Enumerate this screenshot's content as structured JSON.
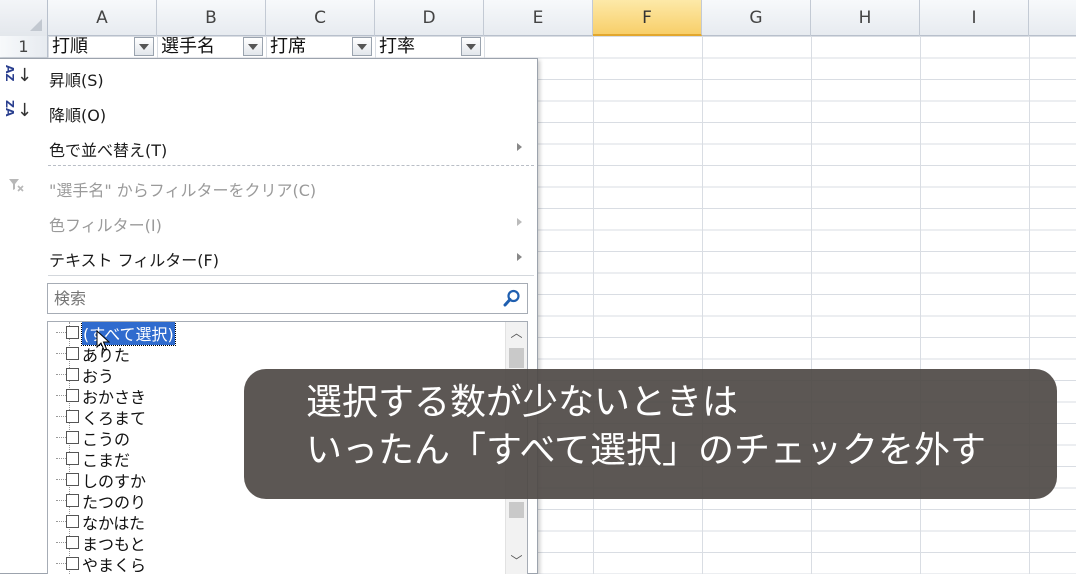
{
  "columns": [
    "A",
    "B",
    "C",
    "D",
    "E",
    "F",
    "G",
    "H",
    "I"
  ],
  "selected_column": "F",
  "row_numbers": [
    "1"
  ],
  "header_row": {
    "A": "打順",
    "B": "選手名",
    "C": "打席",
    "D": "打率"
  },
  "filter_menu": {
    "sort_ascending": "昇順(S)",
    "sort_descending": "降順(O)",
    "sort_by_color": "色で並べ替え(T)",
    "clear_filter": "\"選手名\" からフィルターをクリア(C)",
    "color_filter": "色フィルター(I)",
    "text_filter": "テキスト フィルター(F)",
    "sort_asc_icon": "AZ",
    "sort_desc_icon": "ZA"
  },
  "search": {
    "placeholder": "検索"
  },
  "checklist": [
    "(すべて選択)",
    "ありた",
    "おう",
    "おかさき",
    "くろまて",
    "こうの",
    "こまだ",
    "しのすか",
    "たつのり",
    "なかはた",
    "まつもと",
    "やまくら"
  ],
  "caption": {
    "line1": "選択する数が少ないときは",
    "line2": "いったん「すべて選択」のチェックを外す"
  },
  "colors": {
    "accent_highlight": "#2f6bce",
    "selected_column_bg": "#f8cf6a",
    "caption_bg": "#4e4945"
  },
  "icons": {
    "filter_clear": "funnel-x-icon",
    "search": "magnifier-icon"
  }
}
